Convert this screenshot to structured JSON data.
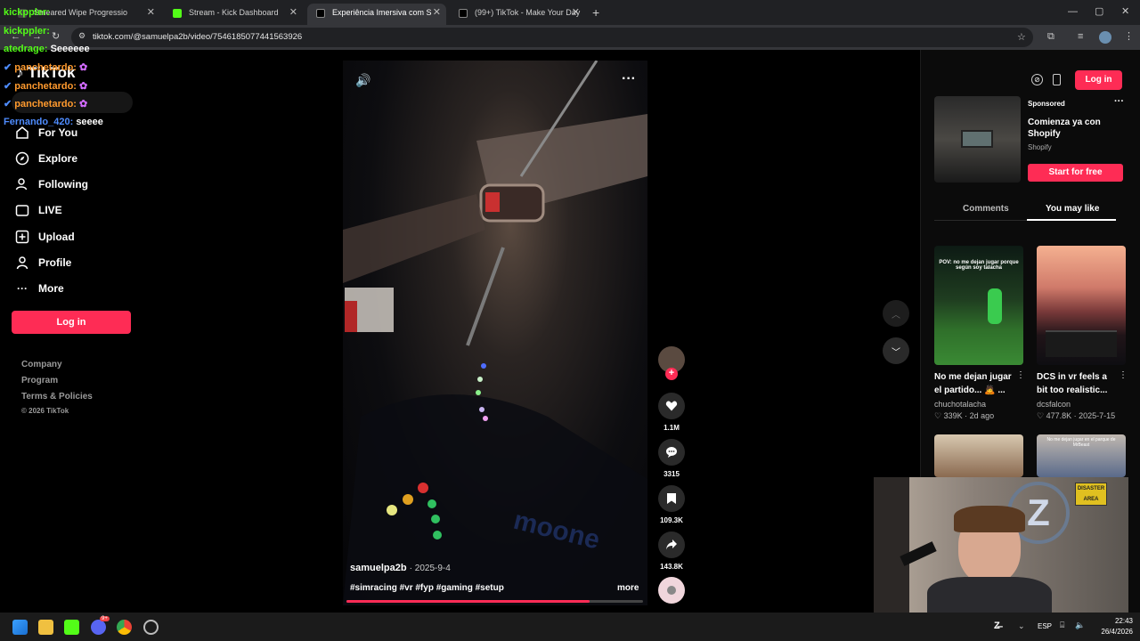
{
  "browser": {
    "tabs": [
      {
        "title": "Smeared Wipe Progressio",
        "active": false
      },
      {
        "title": "Stream - Kick Dashboard",
        "active": false
      },
      {
        "title": "Experiência Imersiva com S",
        "active": true
      },
      {
        "title": "(99+) TikTok - Make Your Day",
        "active": false
      }
    ],
    "url": "tiktok.com/@samuelpa2b/video/7546185077441563926"
  },
  "chat": [
    {
      "user": "kickppler:",
      "message": "",
      "color": "#53fc18"
    },
    {
      "user": "kickppler:",
      "message": "",
      "color": "#53fc18"
    },
    {
      "user": "atedrage:",
      "message": "Seeeeee",
      "color": "#53fc18"
    },
    {
      "user": "panchetardo:",
      "message": "",
      "color": "#ff9a2e"
    },
    {
      "user": "panchetardo:",
      "message": "",
      "color": "#ff9a2e"
    },
    {
      "user": "panchetardo:",
      "message": "",
      "color": "#ff9a2e"
    },
    {
      "user": "Fernando_420:",
      "message": "seeee",
      "color": "#4e8cff"
    }
  ],
  "sidebar": {
    "logo": "TikTok",
    "nav": [
      {
        "label": "For You",
        "icon": "home-icon"
      },
      {
        "label": "Explore",
        "icon": "compass-icon"
      },
      {
        "label": "Following",
        "icon": "following-icon"
      },
      {
        "label": "LIVE",
        "icon": "live-icon"
      },
      {
        "label": "Upload",
        "icon": "upload-icon"
      },
      {
        "label": "Profile",
        "icon": "profile-icon"
      },
      {
        "label": "More",
        "icon": "more-icon"
      }
    ],
    "login_label": "Log in",
    "footer": [
      "Company",
      "Program",
      "Terms & Policies",
      "© 2026 TikTok"
    ]
  },
  "video": {
    "author": "samuelpa2b",
    "date": "· 2025-9-4",
    "hashtags": "#simracing #vr #fyp #gaming #setup",
    "more_label": "more",
    "progress": 0.82,
    "likes": "1.1M",
    "comments": "3315",
    "saves": "109.3K",
    "shares": "143.8K"
  },
  "right_panel": {
    "login_label": "Log in",
    "ad": {
      "sponsored": "Sponsored",
      "title": "Comienza ya con Shopify",
      "brand": "Shopify",
      "cta": "Start for free"
    },
    "tabs": [
      "Comments",
      "You may like"
    ],
    "active_tab": "You may like",
    "recommendations": [
      {
        "title": "No me dejan jugar el partido... 🙇 ...",
        "author": "chuchotalacha",
        "likes": "339K",
        "time": "· 2d ago",
        "overlay": "POV: no me dejan jugar porque según soy talacha"
      },
      {
        "title": "DCS in vr feels a bit too realistic...",
        "author": "dcsfalcon",
        "likes": "477.8K",
        "time": "· 2025-7-15",
        "overlay": ""
      }
    ],
    "partial_overlay": "No me dejan jugar en el parque de MrBeast",
    "partial_sign": "DISASTER AREA"
  },
  "taskbar": {
    "lang": "ESP",
    "time": "22:43",
    "date": "26/4/2026",
    "discord_badge": "9+"
  },
  "colors": {
    "accent": "#fe2c55",
    "kick_green": "#53fc18"
  }
}
